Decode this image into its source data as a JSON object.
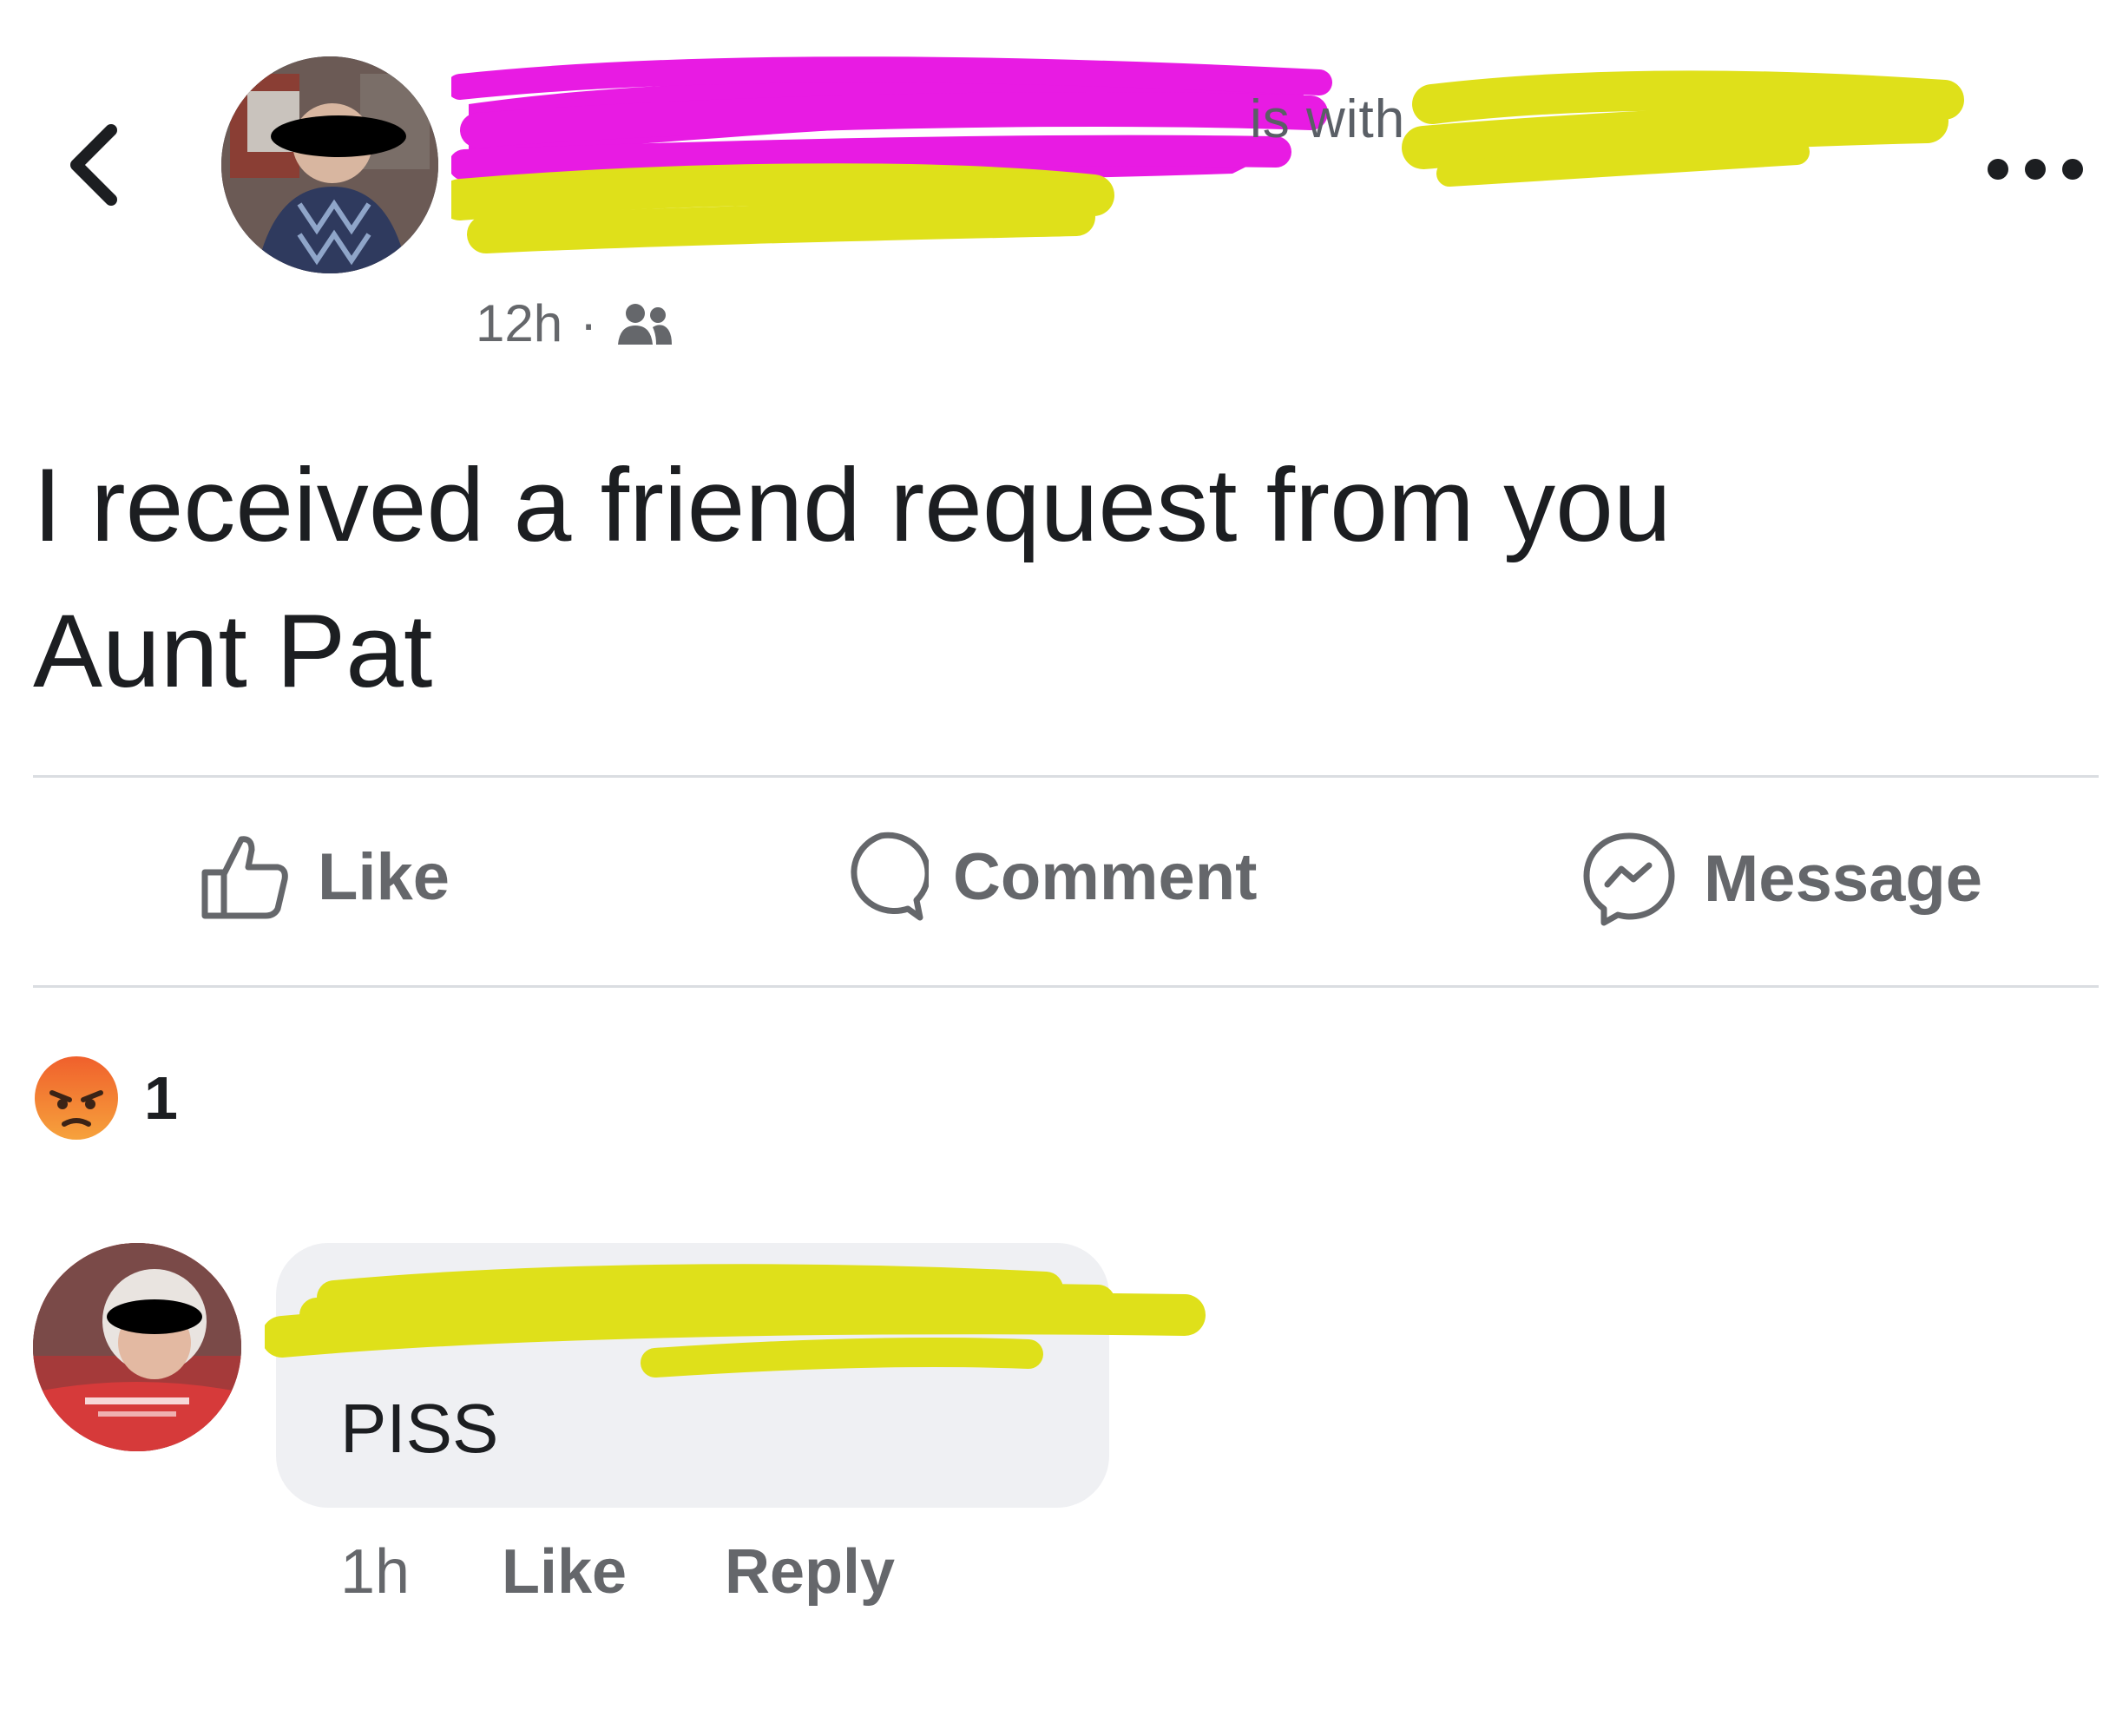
{
  "header": {
    "back_icon": "chevron-left-icon",
    "with_text": "is with",
    "more_icon": "ellipsis-icon",
    "timestamp": "12h",
    "separator": "·",
    "audience_icon": "friends-icon",
    "scribble_colors": {
      "magenta": "#e81be3",
      "yellow": "#dfe01a"
    }
  },
  "post": {
    "text_line1": "I received a friend request from you",
    "text_line2": "Aunt Pat"
  },
  "actions": {
    "like_label": "Like",
    "comment_label": "Comment",
    "message_label": "Message"
  },
  "reactions": {
    "icon": "angry-face-icon",
    "count": "1"
  },
  "comment": {
    "text": "PISS",
    "time": "1h",
    "like_label": "Like",
    "reply_label": "Reply"
  },
  "colors": {
    "secondary_text": "#65676b",
    "angry_orange": "#f0763a",
    "bubble_bg": "#eff0f3"
  }
}
